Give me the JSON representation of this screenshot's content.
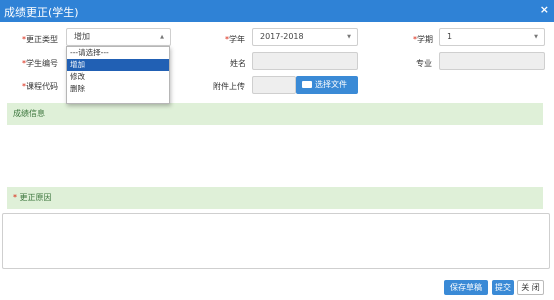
{
  "dialog": {
    "title": "成绩更正(学生)",
    "close_icon": "×"
  },
  "form": {
    "correction_type": {
      "label": "更正类型",
      "required": "*",
      "value": "增加"
    },
    "academic_year": {
      "label": "学年",
      "required": "*",
      "value": "2017-2018"
    },
    "term": {
      "label": "学期",
      "required": "*",
      "value": "1"
    },
    "student_id": {
      "label": "学生编号",
      "required": "*"
    },
    "name": {
      "label": "姓名"
    },
    "major": {
      "label": "专业"
    },
    "course_code": {
      "label": "课程代码",
      "required": "*"
    },
    "attachment": {
      "label": "附件上传",
      "button": "选择文件"
    },
    "caret": "▲",
    "caret_down": "▼"
  },
  "dropdown": {
    "options": [
      "---请选择---",
      "增加",
      "修改",
      "删除"
    ],
    "selected_index": 1
  },
  "sections": {
    "grade_info": "成绩信息",
    "reason": {
      "required": "*",
      "label": "更正原因"
    }
  },
  "footer": {
    "save_draft": "保存草稿",
    "submit": "提交",
    "close": "关 闭"
  },
  "colors": {
    "titlebar": "#2f82d6",
    "section_bg": "#dff0d8",
    "button_primary": "#3a8ad6",
    "selected_option": "#2160b4"
  }
}
